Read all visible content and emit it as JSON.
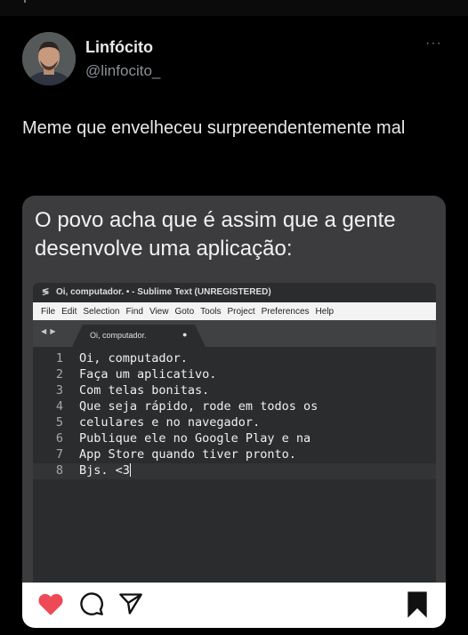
{
  "post": {
    "author_name": "Linfócito",
    "author_handle": "@linfocito_",
    "more_menu": "···",
    "text": "Meme que envelheceu surpreendentemente mal"
  },
  "meme": {
    "caption": "O povo acha que é assim que a gente desenvolve uma aplicação:",
    "editor": {
      "window_title": "Oi, computador. • - Sublime Text (UNREGISTERED)",
      "title_icon": "sublime-icon",
      "menu": [
        "File",
        "Edit",
        "Selection",
        "Find",
        "View",
        "Goto",
        "Tools",
        "Project",
        "Preferences",
        "Help"
      ],
      "tab_arrows": "◀ ▶",
      "tab_label": "Oi, computador.",
      "tab_dirty_marker": "●",
      "lines": [
        {
          "num": "1",
          "text": "Oi, computador."
        },
        {
          "num": "2",
          "text": "Faça um aplicativo."
        },
        {
          "num": "3",
          "text": "Com telas bonitas."
        },
        {
          "num": "4",
          "text": "Que seja rápido, rode em todos os"
        },
        {
          "num": "5",
          "text": "celulares e no navegador."
        },
        {
          "num": "6",
          "text": "Publique ele no Google Play e na"
        },
        {
          "num": "7",
          "text": "App Store quando tiver pronto."
        },
        {
          "num": "8",
          "text": "Bjs. <3"
        }
      ]
    }
  },
  "actions": {
    "like_icon": "heart-icon",
    "comment_icon": "comment-icon",
    "share_icon": "send-icon",
    "save_icon": "bookmark-icon",
    "like_color": "#ed4956"
  }
}
